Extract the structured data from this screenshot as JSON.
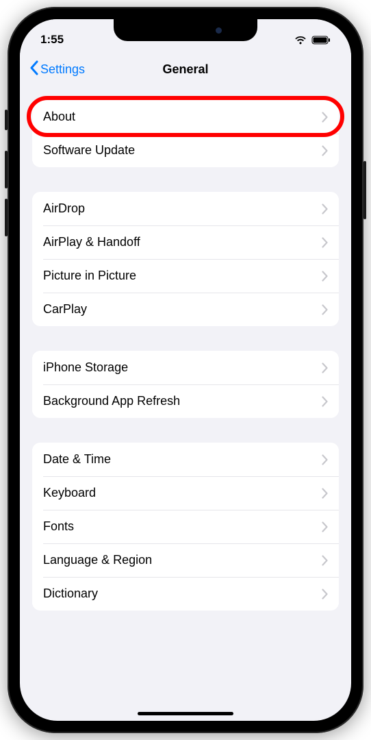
{
  "status": {
    "time": "1:55"
  },
  "nav": {
    "back_label": "Settings",
    "title": "General"
  },
  "groups": [
    {
      "items": [
        {
          "label": "About",
          "highlight": true
        },
        {
          "label": "Software Update"
        }
      ]
    },
    {
      "items": [
        {
          "label": "AirDrop"
        },
        {
          "label": "AirPlay & Handoff"
        },
        {
          "label": "Picture in Picture"
        },
        {
          "label": "CarPlay"
        }
      ]
    },
    {
      "items": [
        {
          "label": "iPhone Storage"
        },
        {
          "label": "Background App Refresh"
        }
      ]
    },
    {
      "items": [
        {
          "label": "Date & Time"
        },
        {
          "label": "Keyboard"
        },
        {
          "label": "Fonts"
        },
        {
          "label": "Language & Region"
        },
        {
          "label": "Dictionary"
        }
      ]
    }
  ]
}
